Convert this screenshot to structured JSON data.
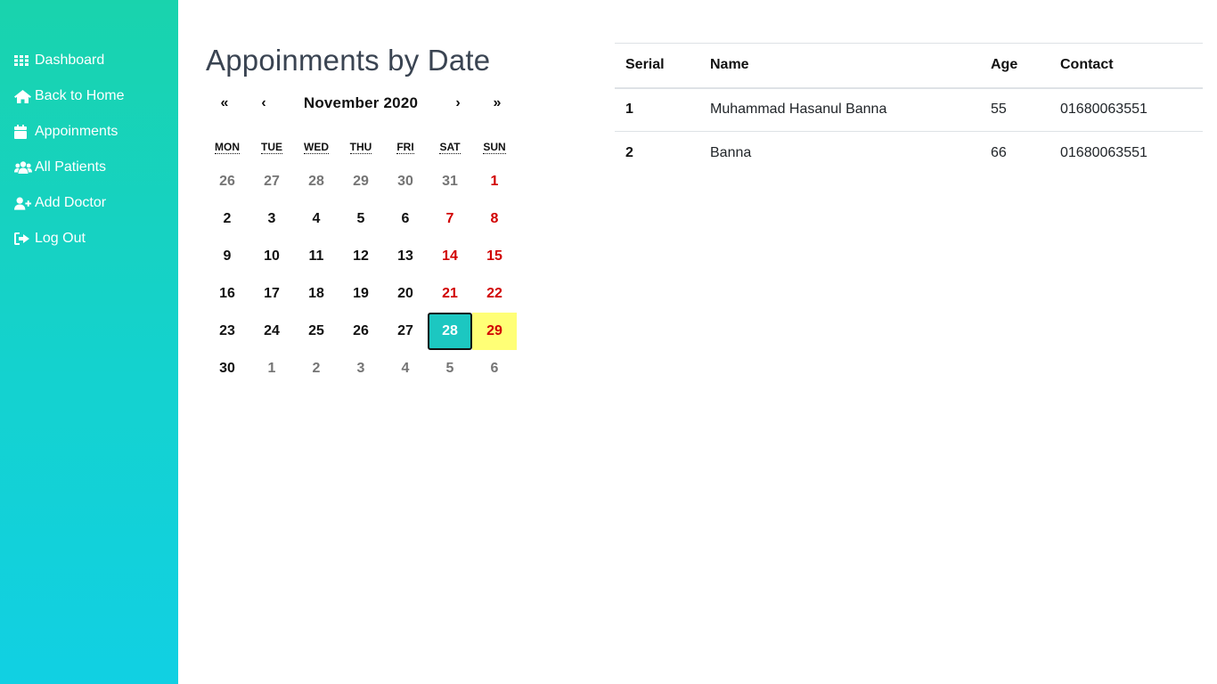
{
  "sidebar": {
    "items": [
      {
        "label": "Dashboard",
        "icon": "grid-icon"
      },
      {
        "label": "Back to Home",
        "icon": "home-icon"
      },
      {
        "label": "Appoinments",
        "icon": "calendar-icon"
      },
      {
        "label": "All Patients",
        "icon": "users-icon"
      },
      {
        "label": "Add Doctor",
        "icon": "user-plus-icon"
      },
      {
        "label": "Log Out",
        "icon": "sign-out-icon"
      }
    ]
  },
  "page": {
    "title": "Appoinments by Date"
  },
  "calendar": {
    "nav": {
      "prev_year": "«",
      "prev_month": "‹",
      "label": "November 2020",
      "next_month": "›",
      "next_year": "»"
    },
    "weekdays": [
      "MON",
      "TUE",
      "WED",
      "THU",
      "FRI",
      "SAT",
      "SUN"
    ],
    "weeks": [
      [
        "26",
        "27",
        "28",
        "29",
        "30",
        "31",
        "1"
      ],
      [
        "2",
        "3",
        "4",
        "5",
        "6",
        "7",
        "8"
      ],
      [
        "9",
        "10",
        "11",
        "12",
        "13",
        "14",
        "15"
      ],
      [
        "16",
        "17",
        "18",
        "19",
        "20",
        "21",
        "22"
      ],
      [
        "23",
        "24",
        "25",
        "26",
        "27",
        "28",
        "29"
      ],
      [
        "30",
        "1",
        "2",
        "3",
        "4",
        "5",
        "6"
      ]
    ],
    "selected_date": "28",
    "today_date": "29",
    "colors": {
      "selected": "#1cc7c1",
      "today": "#ffff76",
      "weekend": "#d10000",
      "neighbor_month": "#757575"
    }
  },
  "table": {
    "headers": [
      "Serial",
      "Name",
      "Age",
      "Contact"
    ],
    "rows": [
      {
        "serial": "1",
        "name": "Muhammad Hasanul Banna",
        "age": "55",
        "contact": "01680063551"
      },
      {
        "serial": "2",
        "name": "Banna",
        "age": "66",
        "contact": "01680063551"
      }
    ]
  },
  "colors": {
    "sidebar_top": "#19d3ad",
    "sidebar_bottom": "#11d0e3",
    "title": "#3a4452"
  }
}
